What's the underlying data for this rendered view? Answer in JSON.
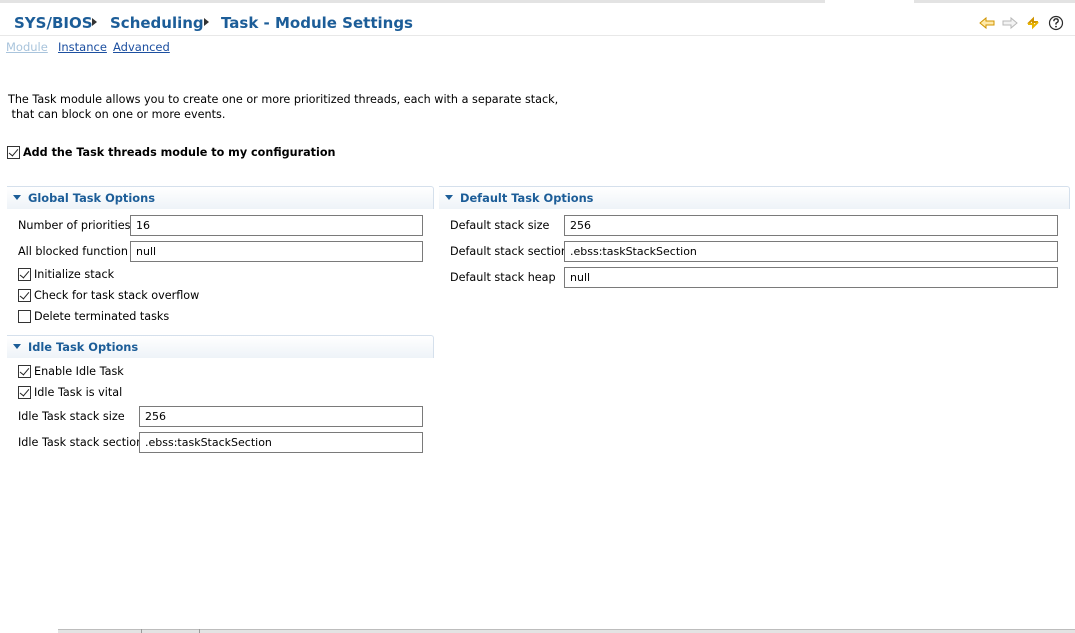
{
  "breadcrumb": {
    "items": [
      "SYS/BIOS",
      "Scheduling",
      "Task - Module Settings"
    ]
  },
  "toolbar": {
    "icons": [
      "back-arrow-icon",
      "forward-arrow-icon",
      "sync-icon",
      "help-icon"
    ],
    "accent": "#f0b000"
  },
  "tabs": [
    {
      "label": "Module",
      "active": true
    },
    {
      "label": "Instance",
      "active": false
    },
    {
      "label": "Advanced",
      "active": false
    }
  ],
  "description": "The Task module allows you to create one or more prioritized threads, each with a separate stack,\n that can block on one or more events.",
  "add_module": {
    "label": "Add the Task threads module to my configuration",
    "checked": true
  },
  "global_options": {
    "title": "Global Task Options",
    "num_priorities": {
      "label": "Number of priorities",
      "value": "16"
    },
    "all_blocked_fn": {
      "label": "All blocked function",
      "value": "null"
    },
    "initialize_stack": {
      "label": "Initialize stack",
      "checked": true
    },
    "check_overflow": {
      "label": "Check for task stack overflow",
      "checked": true
    },
    "delete_terminated": {
      "label": "Delete terminated tasks",
      "checked": false
    }
  },
  "idle_options": {
    "title": "Idle Task Options",
    "enable_idle": {
      "label": "Enable Idle Task",
      "checked": true
    },
    "idle_vital": {
      "label": "Idle Task is vital",
      "checked": true
    },
    "idle_stack_size": {
      "label": "Idle Task stack size",
      "value": "256"
    },
    "idle_stack_section": {
      "label": "Idle Task stack section",
      "value": ".ebss:taskStackSection"
    }
  },
  "default_options": {
    "title": "Default Task Options",
    "stack_size": {
      "label": "Default stack size",
      "value": "256"
    },
    "stack_section": {
      "label": "Default stack section",
      "value": ".ebss:taskStackSection"
    },
    "stack_heap": {
      "label": "Default stack heap",
      "value": "null"
    }
  },
  "colors": {
    "heading": "#1c5d98",
    "link": "#1c4fa0",
    "active_tab": "#a9c4dc"
  }
}
